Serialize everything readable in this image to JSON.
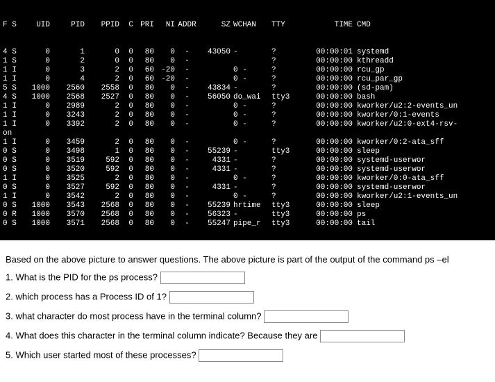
{
  "terminal": {
    "headers": [
      "F S",
      "UID",
      "PID",
      "PPID",
      "C",
      "PRI",
      "NI",
      "ADDR",
      "SZ",
      "WCHAN",
      "TTY",
      "TIME",
      "CMD"
    ],
    "rows": [
      {
        "fs": "4 S",
        "uid": "0",
        "pid": "1",
        "ppid": "0",
        "c": "0",
        "pri": "80",
        "ni": "0",
        "addr": "-",
        "sz": "43050",
        "wchan": "-",
        "tty": "?",
        "time": "00:00:01",
        "cmd": "systemd"
      },
      {
        "fs": "1 S",
        "uid": "0",
        "pid": "2",
        "ppid": "0",
        "c": "0",
        "pri": "80",
        "ni": "0",
        "addr": "-",
        "sz": "",
        "wchan": "",
        "tty": "?",
        "time": "00:00:00",
        "cmd": "kthreadd"
      },
      {
        "fs": "1 I",
        "uid": "0",
        "pid": "3",
        "ppid": "2",
        "c": "0",
        "pri": "60",
        "ni": "-20",
        "addr": "-",
        "sz": "",
        "wchan": "0 -",
        "tty": "?",
        "time": "00:00:00",
        "cmd": "rcu_gp"
      },
      {
        "fs": "1 I",
        "uid": "0",
        "pid": "4",
        "ppid": "2",
        "c": "0",
        "pri": "60",
        "ni": "-20",
        "addr": "-",
        "sz": "",
        "wchan": "0 -",
        "tty": "?",
        "time": "00:00:00",
        "cmd": "rcu_par_gp"
      },
      {
        "fs": "5 S",
        "uid": "1000",
        "pid": "2560",
        "ppid": "2558",
        "c": "0",
        "pri": "80",
        "ni": "0",
        "addr": "-",
        "sz": "43834",
        "wchan": "-",
        "tty": "?",
        "time": "00:00:00",
        "cmd": "(sd-pam)"
      },
      {
        "fs": "4 S",
        "uid": "1000",
        "pid": "2568",
        "ppid": "2527",
        "c": "0",
        "pri": "80",
        "ni": "0",
        "addr": "-",
        "sz": "56050",
        "wchan": "do_wai",
        "tty": "tty3",
        "time": "00:00:00",
        "cmd": "bash"
      },
      {
        "fs": "1 I",
        "uid": "0",
        "pid": "2989",
        "ppid": "2",
        "c": "0",
        "pri": "80",
        "ni": "0",
        "addr": "-",
        "sz": "",
        "wchan": "0 -",
        "tty": "?",
        "time": "00:00:00",
        "cmd": "kworker/u2:2-events_un"
      },
      {
        "fs": "1 I",
        "uid": "0",
        "pid": "3243",
        "ppid": "2",
        "c": "0",
        "pri": "80",
        "ni": "0",
        "addr": "-",
        "sz": "",
        "wchan": "0 -",
        "tty": "?",
        "time": "00:00:00",
        "cmd": "kworker/0:1-events"
      },
      {
        "fs": "1 I",
        "uid": "0",
        "pid": "3392",
        "ppid": "2",
        "c": "0",
        "pri": "80",
        "ni": "0",
        "addr": "-",
        "sz": "",
        "wchan": "0 -",
        "tty": "?",
        "time": "00:00:00",
        "cmd": "kworker/u2:0-ext4-rsv-"
      },
      {
        "fs": "on",
        "uid": "",
        "pid": "",
        "ppid": "",
        "c": "",
        "pri": "",
        "ni": "",
        "addr": "",
        "sz": "",
        "wchan": "",
        "tty": "",
        "time": "",
        "cmd": ""
      },
      {
        "fs": "1 I",
        "uid": "0",
        "pid": "3459",
        "ppid": "2",
        "c": "0",
        "pri": "80",
        "ni": "0",
        "addr": "-",
        "sz": "",
        "wchan": "0 -",
        "tty": "?",
        "time": "00:00:00",
        "cmd": "kworker/0:2-ata_sff"
      },
      {
        "fs": "0 S",
        "uid": "0",
        "pid": "3498",
        "ppid": "1",
        "c": "0",
        "pri": "80",
        "ni": "0",
        "addr": "-",
        "sz": "55239",
        "wchan": "-",
        "tty": "tty3",
        "time": "00:00:00",
        "cmd": "sleep"
      },
      {
        "fs": "0 S",
        "uid": "0",
        "pid": "3519",
        "ppid": "592",
        "c": "0",
        "pri": "80",
        "ni": "0",
        "addr": "-",
        "sz": "4331",
        "wchan": "-",
        "tty": "?",
        "time": "00:00:00",
        "cmd": "systemd-userwor"
      },
      {
        "fs": "0 S",
        "uid": "0",
        "pid": "3520",
        "ppid": "592",
        "c": "0",
        "pri": "80",
        "ni": "0",
        "addr": "-",
        "sz": "4331",
        "wchan": "-",
        "tty": "?",
        "time": "00:00:00",
        "cmd": "systemd-userwor"
      },
      {
        "fs": "1 I",
        "uid": "0",
        "pid": "3525",
        "ppid": "2",
        "c": "0",
        "pri": "80",
        "ni": "0",
        "addr": "-",
        "sz": "",
        "wchan": "0 -",
        "tty": "?",
        "time": "00:00:00",
        "cmd": "kworker/0:0-ata_sff"
      },
      {
        "fs": "0 S",
        "uid": "0",
        "pid": "3527",
        "ppid": "592",
        "c": "0",
        "pri": "80",
        "ni": "0",
        "addr": "-",
        "sz": "4331",
        "wchan": "-",
        "tty": "?",
        "time": "00:00:00",
        "cmd": "systemd-userwor"
      },
      {
        "fs": "1 I",
        "uid": "0",
        "pid": "3542",
        "ppid": "2",
        "c": "0",
        "pri": "80",
        "ni": "0",
        "addr": "-",
        "sz": "",
        "wchan": "0 -",
        "tty": "?",
        "time": "00:00:00",
        "cmd": "kworker/u2:1-events_un"
      },
      {
        "fs": "0 S",
        "uid": "1000",
        "pid": "3543",
        "ppid": "2568",
        "c": "0",
        "pri": "80",
        "ni": "0",
        "addr": "-",
        "sz": "55239",
        "wchan": "hrtime",
        "tty": "tty3",
        "time": "00:00:00",
        "cmd": "sleep"
      },
      {
        "fs": "0 R",
        "uid": "1000",
        "pid": "3570",
        "ppid": "2568",
        "c": "0",
        "pri": "80",
        "ni": "0",
        "addr": "-",
        "sz": "56323",
        "wchan": "-",
        "tty": "tty3",
        "time": "00:00:00",
        "cmd": "ps"
      },
      {
        "fs": "0 S",
        "uid": "1000",
        "pid": "3571",
        "ppid": "2568",
        "c": "0",
        "pri": "80",
        "ni": "0",
        "addr": "-",
        "sz": "55247",
        "wchan": "pipe_r",
        "tty": "tty3",
        "time": "00:00:00",
        "cmd": "tail"
      }
    ]
  },
  "questions": {
    "intro": "Based on the above picture to answer questions. The above picture is part of the output of the command  ps –el",
    "q1": "1. What is the PID for the ps process?",
    "q2": "2. which process has a Process ID of 1?",
    "q3": "3. what character do most process have in the terminal column?",
    "q4": "4. What does this character in the terminal column indicate?  Because they are",
    "q5": "5. Which user started most of these processes?"
  }
}
